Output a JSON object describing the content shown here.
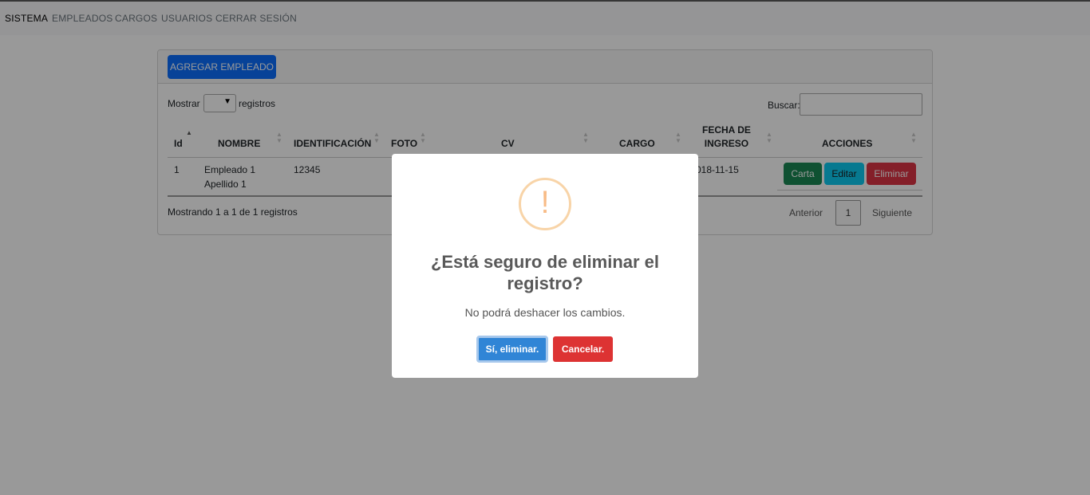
{
  "nav": {
    "brand": "SISTEMA",
    "links": [
      "EMPLEADOS",
      "CARGOS",
      "USUARIOS",
      "CERRAR SESIÓN"
    ]
  },
  "card": {
    "add_button": "AGREGAR EMPLEADO",
    "show_label": "Mostrar",
    "records_label": "registros",
    "page_length_value": "",
    "search_label": "Buscar:",
    "search_value": "",
    "columns": [
      "Id",
      "NOMBRE",
      "IDENTIFICACIÓN",
      "FOTO",
      "CV",
      "CARGO",
      "FECHA DE INGRESO",
      "ACCIONES"
    ],
    "column_fecha_line1": "FECHA DE",
    "column_fecha_line2": "INGRESO",
    "rows": [
      {
        "id": "1",
        "nombre_line1": "Empleado 1",
        "nombre_line2": "Apellido 1",
        "identificacion": "12345",
        "foto": "",
        "cv": "",
        "cargo": "",
        "fecha_visible": "018-11-15",
        "actions": [
          "Carta",
          "Editar",
          "Eliminar"
        ]
      }
    ],
    "info": "Mostrando 1 a 1 de 1 registros",
    "pagination": {
      "prev": "Anterior",
      "current": "1",
      "next": "Siguiente"
    }
  },
  "modal": {
    "icon": "exclamation-icon",
    "title": "¿Está seguro de eliminar el registro?",
    "text": "No podrá deshacer los cambios.",
    "confirm_label": "Sí, eliminar.",
    "cancel_label": "Cancelar."
  },
  "colors": {
    "primary": "#0d6efd",
    "success": "#198754",
    "info": "#0dcaf0",
    "danger": "#dc3545",
    "confirm": "#3085d6",
    "cancel": "#dd3333",
    "warning_icon": "#f8bb86"
  }
}
